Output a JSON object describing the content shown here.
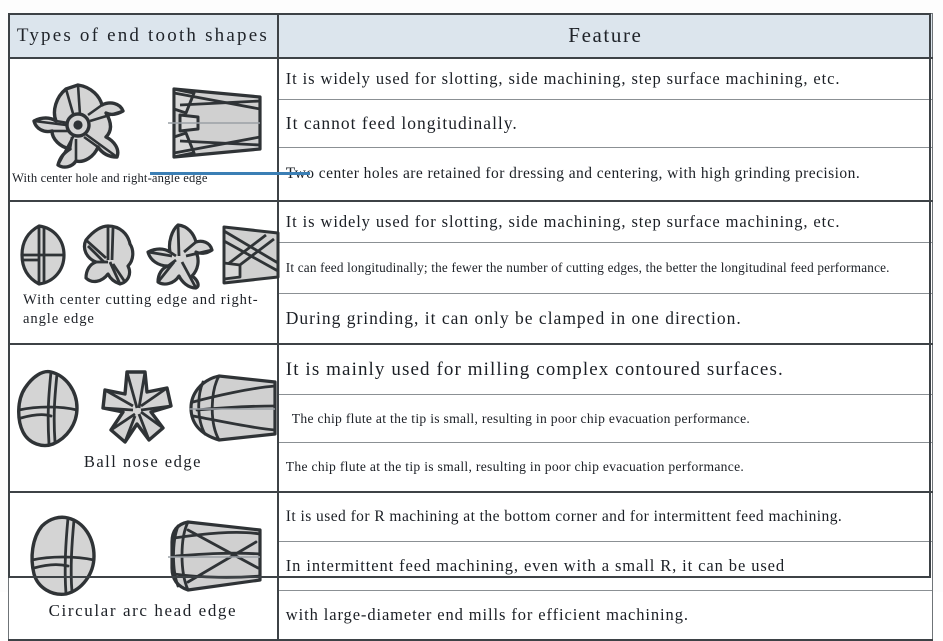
{
  "header": {
    "col_types": "Types of end tooth shapes",
    "col_feature": "Feature",
    "bg_color": "#dce5ed"
  },
  "accent_color": "#3b7fb5",
  "border_color": "#3d4246",
  "rows": [
    {
      "label": "With center hole and right-angle edge",
      "illustrations": [
        "endmill-face-4flute-center-hole",
        "endmill-side-right-angle"
      ],
      "features": [
        "It is widely used for slotting, side machining, step surface machining, etc.",
        "It cannot feed longitudinally.",
        "Two center holes are retained for dressing and centering, with high grinding precision."
      ]
    },
    {
      "label": "With center cutting edge and right-angle edge",
      "illustrations": [
        "endmill-face-2flute",
        "endmill-face-3flute",
        "endmill-face-4flute",
        "endmill-side-center-cutting"
      ],
      "features": [
        "It is widely used for slotting, side machining, step surface machining, etc.",
        "It can feed longitudinally; the fewer the number of cutting edges, the better the longitudinal feed performance.",
        "During grinding, it can only be clamped in one direction."
      ]
    },
    {
      "label": "Ball nose edge",
      "illustrations": [
        "ballnose-face-2flute",
        "ballnose-face-4flute",
        "ballnose-side"
      ],
      "features": [
        "It is mainly used for milling complex contoured surfaces.",
        "The chip flute at the tip is small, resulting in poor chip evacuation performance.",
        "The chip flute at the tip is small, resulting in poor chip evacuation performance."
      ]
    },
    {
      "label": "Circular arc head edge",
      "illustrations": [
        "radius-face-2flute",
        "radius-side"
      ],
      "features": [
        "It is used for R machining at the bottom corner and for intermittent feed machining.",
        "In intermittent feed machining, even with a small R, it can be used",
        "with    large-diameter end mills for efficient machining."
      ]
    }
  ]
}
